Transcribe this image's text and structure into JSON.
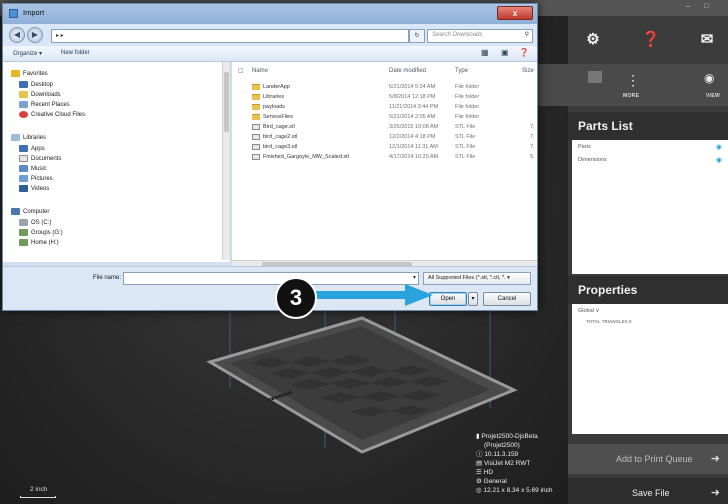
{
  "dialog": {
    "title": "Import",
    "address": "▸ ▸",
    "search_placeholder": "Search Downloads",
    "commands": {
      "organize": "Organize ▾",
      "new_folder": "New folder"
    },
    "columns": {
      "name": "Name",
      "date": "Date modified",
      "type": "Type",
      "size": "Size"
    },
    "nav": {
      "favorites_header": "Favorites",
      "favorites": [
        "Desktop",
        "Downloads",
        "Recent Places",
        "Creative Cloud Files"
      ],
      "libraries_header": "Libraries",
      "libraries": [
        "Apps",
        "Documents",
        "Music",
        "Pictures",
        "Videos"
      ],
      "computer_header": "Computer",
      "computer": [
        "OS (C:)",
        "Groups (G:)",
        "Home (H:)"
      ]
    },
    "files": [
      {
        "name": "LanderApp",
        "date": "5/21/2014 5:24 AM",
        "type": "File folder",
        "size": "",
        "kind": "folder"
      },
      {
        "name": "Libraries",
        "date": "5/8/2014 12:18 PM",
        "type": "File folder",
        "size": "",
        "kind": "folder"
      },
      {
        "name": "payloads",
        "date": "11/21/2014 3:44 PM",
        "type": "File folder",
        "size": "",
        "kind": "folder"
      },
      {
        "name": "ServiceFiles",
        "date": "5/21/2014 2:05 AM",
        "type": "File folder",
        "size": "",
        "kind": "folder"
      },
      {
        "name": "Bird_cage.stl",
        "date": "3/25/2015 10:08 AM",
        "type": "STL File",
        "size": "7,",
        "kind": "stl"
      },
      {
        "name": "bird_cage2.stl",
        "date": "12/2/2014 4:18 PM",
        "type": "STL File",
        "size": "7,",
        "kind": "stl"
      },
      {
        "name": "bird_cage3.stl",
        "date": "12/1/2014 11:31 AM",
        "type": "STL File",
        "size": "7,",
        "kind": "stl"
      },
      {
        "name": "Finished_Gargoyle_MW_Scaled.stl",
        "date": "4/17/2014 10:20 AM",
        "type": "STL File",
        "size": "5,",
        "kind": "stl"
      }
    ],
    "file_name_label": "File name:",
    "file_name_value": "",
    "filter": "All Supported Files (*.stl, *.ctl, *.",
    "open_label": "Open",
    "cancel_label": "Cancel",
    "close_label": "x"
  },
  "callout": {
    "number": "3"
  },
  "app": {
    "toolbar_labels": {
      "more": "MORE",
      "view": "VIEW",
      "faded1": "...",
      "faded2": "..."
    },
    "parts_list": {
      "title": "Parts List",
      "rows": [
        "Parts",
        "Dimensions"
      ]
    },
    "properties": {
      "title": "Properties",
      "scope": "Global ∨",
      "total_triangles": "TOTAL TRIANGLES   0"
    },
    "add_to_queue": "Add to Print Queue",
    "save_file": "Save File",
    "printer_info": [
      "Projet2500-DjsBeta",
      "(Projet2500)",
      "10.11.3.159",
      "VisiJet M2 RWT",
      "HD",
      "General",
      "12.21 x 8.34 x 5.69 inch"
    ],
    "scale_label": "2 inch"
  },
  "colors": {
    "accent": "#29a3dc",
    "panel": "#3a3a3a",
    "dialog_chrome": "#cfe0f2"
  }
}
